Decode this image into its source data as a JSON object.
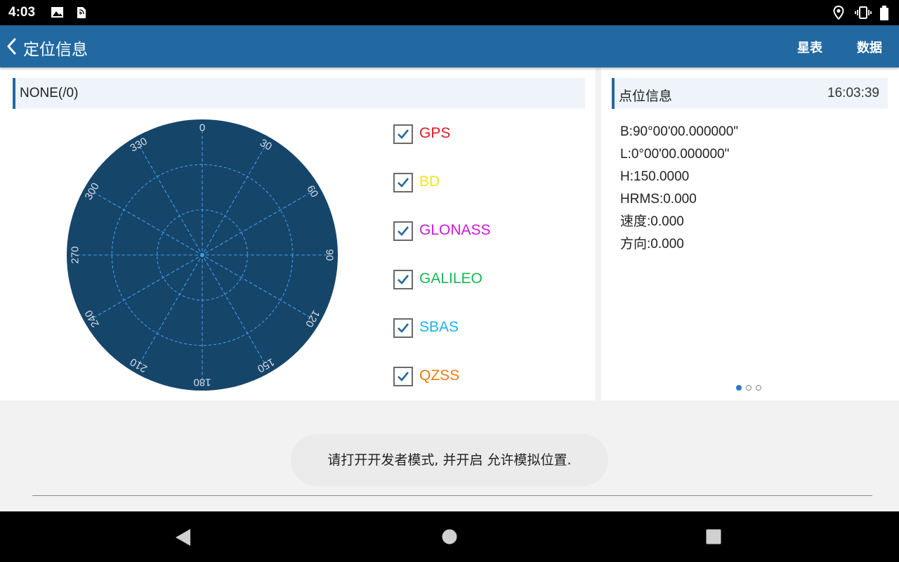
{
  "status_bar": {
    "time": "4:03",
    "icons": [
      "image-icon",
      "sd-card-icon",
      "location-pin-icon",
      "vibrate-icon",
      "battery-icon"
    ]
  },
  "app_bar": {
    "title": "定位信息",
    "actions": {
      "star_table": "星表",
      "data": "数据"
    },
    "color": "#2269a1"
  },
  "skyplot_panel": {
    "header": "NONE(/0)",
    "plot": {
      "background": "#16456a",
      "grid_color": "#3f9be6",
      "labels_color": "#d6dee6",
      "azimuth_labels": [
        "0",
        "30",
        "60",
        "90",
        "120",
        "150",
        "180",
        "210",
        "240",
        "270",
        "300",
        "330"
      ]
    },
    "systems": [
      {
        "name": "GPS",
        "checked": true,
        "color": "#e8171f"
      },
      {
        "name": "BD",
        "checked": true,
        "color": "#f2e51a"
      },
      {
        "name": "GLONASS",
        "checked": true,
        "color": "#cc19d9"
      },
      {
        "name": "GALILEO",
        "checked": true,
        "color": "#14b853"
      },
      {
        "name": "SBAS",
        "checked": true,
        "color": "#1ab3ec"
      },
      {
        "name": "QZSS",
        "checked": true,
        "color": "#ef7a10"
      }
    ]
  },
  "point_info": {
    "header": "点位信息",
    "time": "16:03:39",
    "lines": [
      {
        "label": "B:",
        "value": "90°00'00.000000\""
      },
      {
        "label": "L:",
        "value": "0°00'00.000000\""
      },
      {
        "label": "H:",
        "value": "150.0000"
      },
      {
        "label": "HRMS:",
        "value": "0.000"
      },
      {
        "label": "速度:",
        "value": "0.000"
      },
      {
        "label": "方向:",
        "value": "0.000"
      }
    ],
    "page_indicator": {
      "total": 3,
      "active": 1
    }
  },
  "toast": "请打开开发者模式, 并开启 允许模拟位置.",
  "nav_bar": {
    "buttons": [
      "back-icon",
      "home-icon",
      "recents-icon"
    ]
  }
}
